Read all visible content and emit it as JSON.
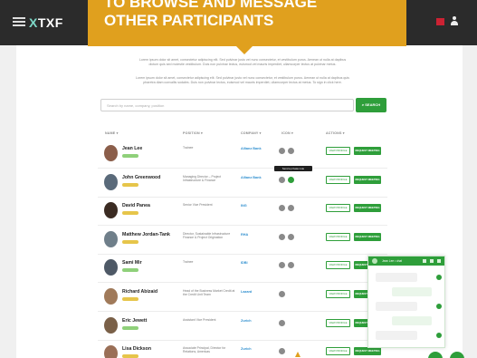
{
  "banner": {
    "line1": "TO BROWSE AND MESSAGE",
    "line2": "OTHER PARTICIPANTS"
  },
  "app": {
    "logo_prefix": "",
    "logo_x": "X",
    "logo_text": "TXF"
  },
  "intro": {
    "p1a": "Lorem ipsum dolor sit amet, consectetur adipiscing elit. Sed pulvinar justo vel nunc consectetur, et vestibulum purus. Aenean ut nulla at dapibus",
    "p1b": "dictum quis sed molestie vestibulum. Duis non pulvinar lectus, euismod vel mauris imperdiet, ullamcorper lectus at pulvinar metus.",
    "p2a": "Lorem ipsum dolor sit amet, consectetur adipiscing elit. Sed pulvinar justo vel nunc consectetur, et vestibulum purus. Aenean ut nulla at dapibus quis",
    "p2b": "pharetra diam convallis sodales. Duis non pulvinar lectus, euismod vel mauris imperdiet, ullamcorper lectus at metus. To sign in click here."
  },
  "search": {
    "placeholder": "Search by name, company, position",
    "button": "SEARCH"
  },
  "table": {
    "headers": [
      "NAME",
      "POSITION",
      "COMPANY",
      "ICON",
      "ACTIONS"
    ],
    "tooltip": "Send a private note",
    "rows": [
      {
        "name": "Jean Lee",
        "position": "Trainee",
        "company": "Allianz Bank"
      },
      {
        "name": "John Greenwood",
        "position": "Managing Director – Project Infrastructure & Finance",
        "company": "Allianz Bank"
      },
      {
        "name": "David Panea",
        "position": "Senior Vice President",
        "company": "ING"
      },
      {
        "name": "Matthew Jordan-Tank",
        "position": "Director, Sustainable Infrastructure Finance & Project Origination",
        "company": "RHA"
      },
      {
        "name": "Sami Mir",
        "position": "Trainee",
        "company": "IDBI"
      },
      {
        "name": "Richard Abizaid",
        "position": "Head of the Business Market Credit at the Credit Unit Team",
        "company": "Lazard"
      },
      {
        "name": "Eric Jewett",
        "position": "Assistant Vice President",
        "company": "Zurich"
      },
      {
        "name": "Lisa Dickson",
        "position": "Associate Principal, Director for Relations, Americas",
        "company": "Zurich"
      }
    ],
    "btn_view": "VIEW PROFILE",
    "btn_request": "REQUEST MEETING"
  },
  "chat": {
    "title": "Jean Lee • chat"
  },
  "colors": {
    "accent": "#2e9e3a",
    "banner": "#e0a01e",
    "link": "#2f8fcf",
    "topbar": "#2b2b2b"
  }
}
